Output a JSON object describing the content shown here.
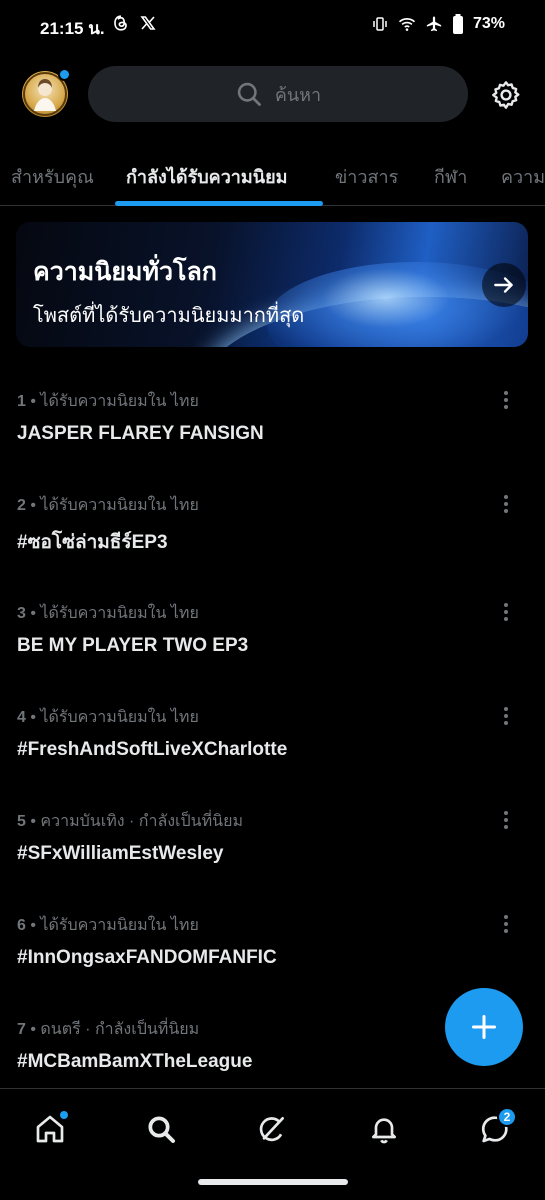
{
  "status": {
    "time": "21:15 น.",
    "battery": "73%"
  },
  "search": {
    "placeholder": "ค้นหา"
  },
  "tabs": [
    {
      "label": "สำหรับคุณ",
      "active": false
    },
    {
      "label": "กำลังได้รับความนิยม",
      "active": true
    },
    {
      "label": "ข่าวสาร",
      "active": false
    },
    {
      "label": "กีฬา",
      "active": false
    },
    {
      "label": "ความ",
      "active": false
    }
  ],
  "banner": {
    "title": "ความนิยมทั่วโลก",
    "subtitle": "โพสต์ที่ได้รับความนิยมมากที่สุด"
  },
  "trends": [
    {
      "rank": "1",
      "context": "ได้รับความนิยมใน ไทย",
      "title": "JASPER FLAREY FANSIGN"
    },
    {
      "rank": "2",
      "context": "ได้รับความนิยมใน ไทย",
      "title": "#ซอโซ่ล่ามธีร์EP3"
    },
    {
      "rank": "3",
      "context": "ได้รับความนิยมใน ไทย",
      "title": "BE MY PLAYER TWO EP3"
    },
    {
      "rank": "4",
      "context": "ได้รับความนิยมใน ไทย",
      "title": "#FreshAndSoftLiveXCharlotte"
    },
    {
      "rank": "5",
      "context": "ความบันเทิง · กำลังเป็นที่นิยม",
      "title": "#SFxWilliamEstWesley"
    },
    {
      "rank": "6",
      "context": "ได้รับความนิยมใน ไทย",
      "title": "#InnOngsaxFANDOMFANFIC"
    },
    {
      "rank": "7",
      "context": "ดนตรี · กำลังเป็นที่นิยม",
      "title": "#MCBamBamXTheLeague"
    }
  ],
  "nav": {
    "items": [
      "home-icon",
      "search-icon",
      "grok-icon",
      "notifications-icon",
      "messages-icon"
    ],
    "messages_badge": "2"
  },
  "colors": {
    "accent": "#1d9bf0",
    "background": "#000000",
    "text_primary": "#e7e9ea",
    "text_secondary": "#71767b"
  }
}
